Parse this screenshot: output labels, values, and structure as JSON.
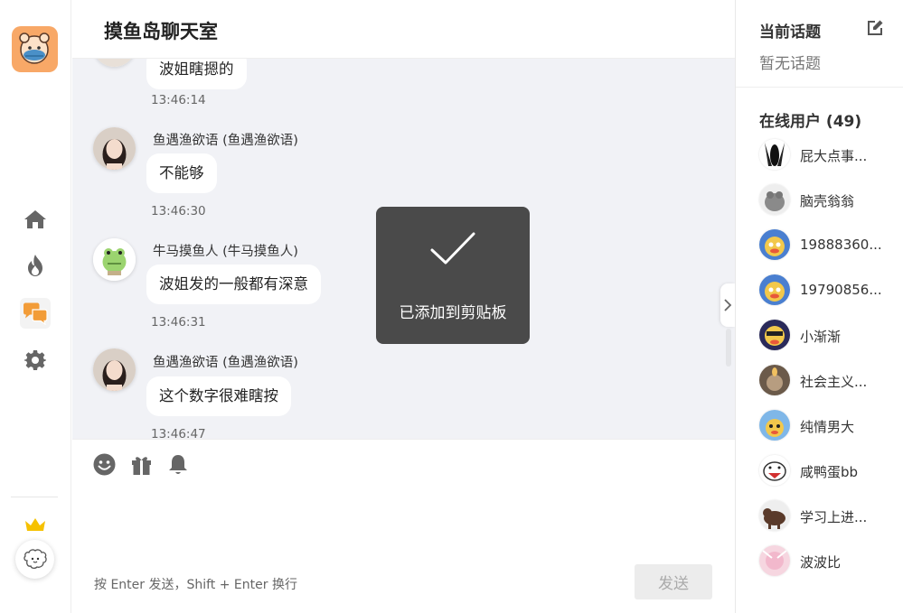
{
  "header": {
    "title": "摸鱼岛聊天室"
  },
  "nav": {
    "items": [
      {
        "icon": "home-icon"
      },
      {
        "icon": "fire-icon"
      },
      {
        "icon": "chat-icon"
      },
      {
        "icon": "gear-icon"
      }
    ]
  },
  "messages": [
    {
      "name": "",
      "text": "波姐瞎摁的",
      "time": "13:46:14"
    },
    {
      "name": "鱼遇渔欲语 (鱼遇渔欲语)",
      "text": "不能够",
      "time": "13:46:30"
    },
    {
      "name": "牛马摸鱼人 (牛马摸鱼人)",
      "text": "波姐发的一般都有深意",
      "time": "13:46:31"
    },
    {
      "name": "鱼遇渔欲语 (鱼遇渔欲语)",
      "text": "这个数字很难瞎按",
      "time": "13:46:47"
    }
  ],
  "toast": {
    "text": "已添加到剪贴板"
  },
  "composer": {
    "hint": "按 Enter 发送，Shift + Enter 换行",
    "send_label": "发送",
    "tools": [
      "emoji-icon",
      "gift-icon",
      "bell-icon"
    ]
  },
  "right_panel": {
    "topic_title": "当前话题",
    "topic_value": "暂无话题",
    "online_title": "在线用户 (49)",
    "users": [
      {
        "name": "屁大点事..."
      },
      {
        "name": "脑壳翁翁"
      },
      {
        "name": "19888360..."
      },
      {
        "name": "19790856..."
      },
      {
        "name": "小渐渐"
      },
      {
        "name": "社会主义..."
      },
      {
        "name": "纯情男大"
      },
      {
        "name": "咸鸭蛋bb"
      },
      {
        "name": "学习上进..."
      },
      {
        "name": "波波比"
      }
    ]
  },
  "colors": {
    "accent": "#f8a867",
    "toast_bg": "#4a4a4a",
    "chat_bg": "#f1f2f6",
    "crown": "#f6c100"
  }
}
